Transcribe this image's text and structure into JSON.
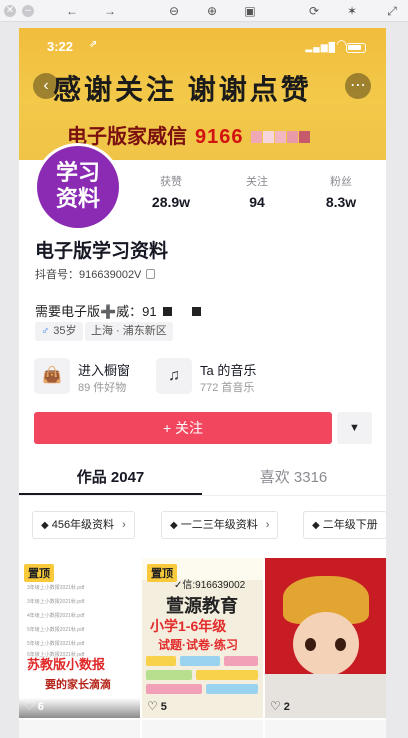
{
  "status_bar": {
    "time": "3:22",
    "location_arrow": "⇗"
  },
  "banner": {
    "line1": "感谢关注  谢谢点赞",
    "line2_prefix": "电子版家威信",
    "line2_number": "9166"
  },
  "profile": {
    "avatar_text_1": "学习",
    "avatar_text_2": "资料",
    "name": "电子版学习资料",
    "douyin_id": "抖音号：916639002V",
    "bio": "需要电子版➕威：91",
    "age_tag": "35岁",
    "gender_icon": "mars-icon",
    "location_tag": "上海 · 浦东新区",
    "stats": [
      {
        "label": "获赞",
        "value": "28.9w"
      },
      {
        "label": "关注",
        "value": "94"
      },
      {
        "label": "粉丝",
        "value": "8.3w"
      }
    ]
  },
  "cards": [
    {
      "title": "进入橱窗",
      "sub": "89 件好物",
      "icon": "shopping-bag-icon"
    },
    {
      "title": "Ta 的音乐",
      "sub": "772 首音乐",
      "icon": "music-note-icon"
    }
  ],
  "follow_button": "+ 关注",
  "tabs": [
    {
      "label": "作品 2047"
    },
    {
      "label": "喜欢 3316"
    }
  ],
  "collections": [
    {
      "label": "456年级资料"
    },
    {
      "label": "一二三年级资料"
    },
    {
      "label": "二年级下册"
    }
  ],
  "videos": [
    {
      "pinned": "置顶",
      "likes": "6",
      "title": "苏教版小数报",
      "subtitle": "要的家长滴滴",
      "files": [
        "3年级上小数报2021秋.pdf",
        "3年级上小数报2021秋.pdf",
        "4年级上小数报2021秋.pdf",
        "5年级上小数报2021秋.pdf",
        "5年级上小数报2021秋.pdf",
        "6年级上小数报2021秋.pdf"
      ]
    },
    {
      "pinned": "置顶",
      "likes": "5",
      "wechat": "✓信:916639002",
      "brand": "萱源教育",
      "line1": "小学1-6年级",
      "line2": "试题·试卷·练习"
    },
    {
      "likes": "2"
    }
  ],
  "colors": {
    "accent": "#f2465f",
    "banner": "#f3c94a",
    "avatar_bg": "#8b2bb3"
  }
}
